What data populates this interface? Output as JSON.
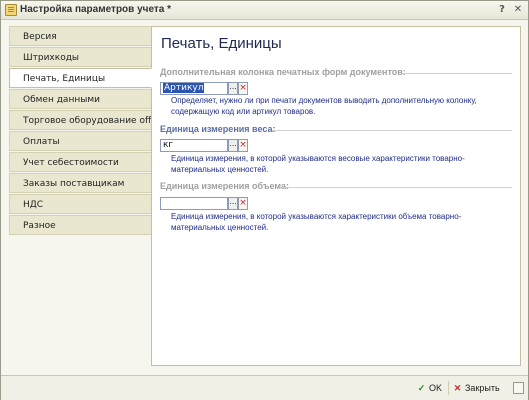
{
  "window": {
    "title": "Настройка параметров учета *",
    "help_glyph": "?",
    "close_glyph": "✕"
  },
  "sidebar": {
    "items": [
      {
        "label": "Версия",
        "active": false
      },
      {
        "label": "Штрихкоды",
        "active": false
      },
      {
        "label": "Печать, Единицы",
        "active": true
      },
      {
        "label": "Обмен данными",
        "active": false
      },
      {
        "label": "Торговое оборудование offline",
        "active": false
      },
      {
        "label": "Оплаты",
        "active": false
      },
      {
        "label": "Учет себестоимости",
        "active": false
      },
      {
        "label": "Заказы поставщикам",
        "active": false
      },
      {
        "label": "НДС",
        "active": false
      },
      {
        "label": "Разное",
        "active": false
      }
    ]
  },
  "main": {
    "title": "Печать, Единицы",
    "groups": [
      {
        "label": "Дополнительная колонка печатных форм документов:",
        "value": "Артикул",
        "description": "Определяет, нужно ли при печати документов выводить дополнительную колонку, содержащую код или артикул товаров."
      },
      {
        "label": "Единица измерения веса:",
        "value": "кг",
        "description": "Единица измерения, в которой указываются весовые характеристики товарно-материальных ценностей."
      },
      {
        "label": "Единица измерения объема:",
        "value": "",
        "description": "Единица измерения, в которой указываются характеристики объема товарно-материальных ценностей."
      }
    ],
    "select_glyph": "...",
    "clear_glyph": "×"
  },
  "footer": {
    "ok_label": "OK",
    "close_label": "Закрыть",
    "ok_glyph": "✓",
    "close_glyph": "✕"
  }
}
